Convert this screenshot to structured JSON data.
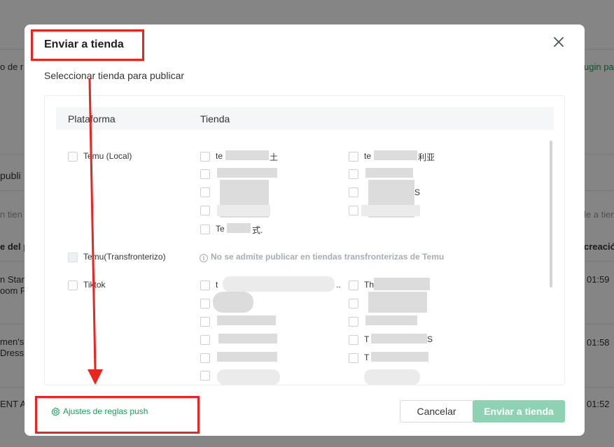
{
  "background": {
    "fragments": [
      {
        "text": "o de r"
      },
      {
        "text": "ugin pa"
      },
      {
        "text": " publi"
      },
      {
        "text": "n tien"
      },
      {
        "text": "le a tien"
      },
      {
        "text": "e del pr"
      },
      {
        "text": "creació"
      },
      {
        "text": "n Star C"
      },
      {
        "text": "oom P"
      },
      {
        "text": "01:59"
      },
      {
        "text": "men's"
      },
      {
        "text": " Dress"
      },
      {
        "text": "01:58"
      },
      {
        "text": "ENT A"
      },
      {
        "text": "01:52"
      }
    ]
  },
  "modal": {
    "title": "Enviar a tienda",
    "subtitle": "Seleccionar tienda para publicar",
    "columns": {
      "platform": "Plataforma",
      "store": "Tienda"
    },
    "platforms": {
      "temu_local": "Temu (Local)",
      "temu_cross": "Temu(Transfronterizo)",
      "tiktok": "Tiktok"
    },
    "temu_cross_hint": "No se admite publicar en tiendas transfronterizas de Temu",
    "hint_icon": "i",
    "store_fragments": {
      "tl_a1": "te",
      "tl_a1_end": "土",
      "tl_b1": "te",
      "tl_b1_end": "利亚",
      "tl_a5": "Te",
      "tl_a5_end": "式.",
      "tl_b3_end": "S",
      "tt_a1": "t",
      "tt_a1_end": "..",
      "tt_b1": "Th",
      "tt_b4_end": "S",
      "tt_b4": "T",
      "tt_b5": "T"
    },
    "footer_link": "Ajustes de reglas push",
    "cancel_label": "Cancelar",
    "submit_label": "Enviar a tienda"
  },
  "icons": {
    "close": "close-icon",
    "gear": "gear-icon",
    "info": "info-icon"
  },
  "colors": {
    "accent": "#18a058",
    "submit_disabled": "#8ed2b4",
    "annotation": "#e8261f"
  }
}
